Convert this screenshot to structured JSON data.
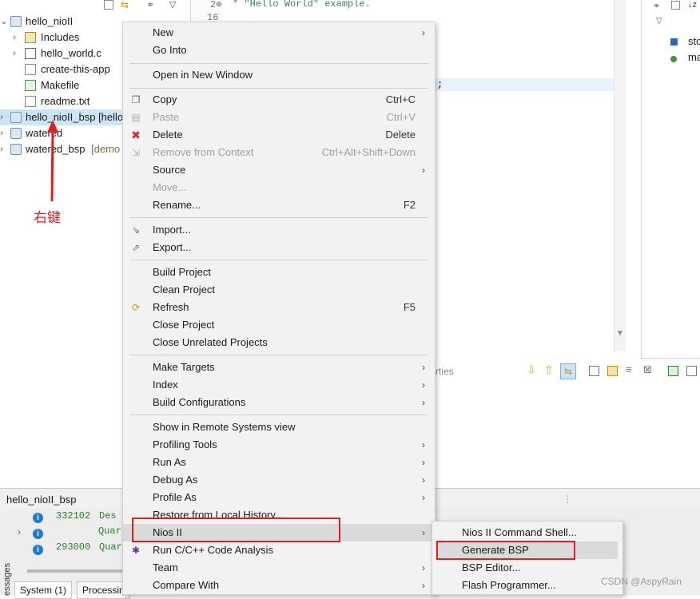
{
  "explorer": {
    "items": [
      {
        "label": "hello_nioII",
        "arrow": "⌄"
      },
      {
        "label": "Includes",
        "arrow": "›"
      },
      {
        "label": "hello_world.c",
        "arrow": "›"
      },
      {
        "label": "create-this-app",
        "arrow": ""
      },
      {
        "label": "Makefile",
        "arrow": ""
      },
      {
        "label": "readme.txt",
        "arrow": ""
      },
      {
        "label": "hello_nioII_bsp [hello",
        "arrow": "›"
      },
      {
        "label": "watered",
        "arrow": "›"
      },
      {
        "label": "watered_bsp",
        "suffix": "[demo",
        "arrow": "›"
      }
    ]
  },
  "annotation": {
    "text": "右键",
    "color": "#e02020"
  },
  "editor": {
    "line_numbers": [
      "2⊕",
      "16"
    ],
    "code_line": "* \"Hello World\" example.",
    "semicolon": ";",
    "properties_tab": "rties"
  },
  "outline": {
    "items": [
      "sto",
      "ma"
    ]
  },
  "context_menu": {
    "items": [
      {
        "label": "New",
        "submenu": true
      },
      {
        "label": "Go Into"
      },
      {
        "label": "Open in New Window"
      },
      {
        "label": "Copy",
        "shortcut": "Ctrl+C",
        "icon": "copy"
      },
      {
        "label": "Paste",
        "shortcut": "Ctrl+V",
        "disabled": true,
        "icon": "paste"
      },
      {
        "label": "Delete",
        "shortcut": "Delete",
        "icon": "delete"
      },
      {
        "label": "Remove from Context",
        "shortcut": "Ctrl+Alt+Shift+Down",
        "disabled": true,
        "icon": "remove"
      },
      {
        "label": "Source",
        "submenu": true
      },
      {
        "label": "Move...",
        "disabled": true
      },
      {
        "label": "Rename...",
        "shortcut": "F2"
      },
      {
        "label": "Import...",
        "icon": "import"
      },
      {
        "label": "Export...",
        "icon": "export"
      },
      {
        "label": "Build Project"
      },
      {
        "label": "Clean Project"
      },
      {
        "label": "Refresh",
        "shortcut": "F5",
        "icon": "refresh"
      },
      {
        "label": "Close Project"
      },
      {
        "label": "Close Unrelated Projects"
      },
      {
        "label": "Make Targets",
        "submenu": true
      },
      {
        "label": "Index",
        "submenu": true
      },
      {
        "label": "Build Configurations",
        "submenu": true
      },
      {
        "label": "Show in Remote Systems view"
      },
      {
        "label": "Profiling Tools",
        "submenu": true
      },
      {
        "label": "Run As",
        "submenu": true
      },
      {
        "label": "Debug As",
        "submenu": true
      },
      {
        "label": "Profile As",
        "submenu": true
      },
      {
        "label": "Restore from Local History..."
      },
      {
        "label": "Nios II",
        "submenu": true
      },
      {
        "label": "Run C/C++ Code Analysis",
        "icon": "analysis"
      },
      {
        "label": "Team",
        "submenu": true
      },
      {
        "label": "Compare With",
        "submenu": true
      }
    ]
  },
  "nios_submenu": {
    "items": [
      {
        "label": "Nios II Command Shell..."
      },
      {
        "label": "Generate BSP"
      },
      {
        "label": "BSP Editor..."
      },
      {
        "label": "Flash Programmer..."
      }
    ]
  },
  "bottom": {
    "panel_title": "hello_nioII_bsp",
    "messages": [
      {
        "id": "332102",
        "text": "Des"
      },
      {
        "id": "",
        "text": "Quar"
      },
      {
        "id": "293000",
        "text": "Quar"
      }
    ],
    "side_label": "essages",
    "tabs": [
      "System (1)",
      "Processin"
    ]
  },
  "watermark": "CSDN @AspyRain"
}
